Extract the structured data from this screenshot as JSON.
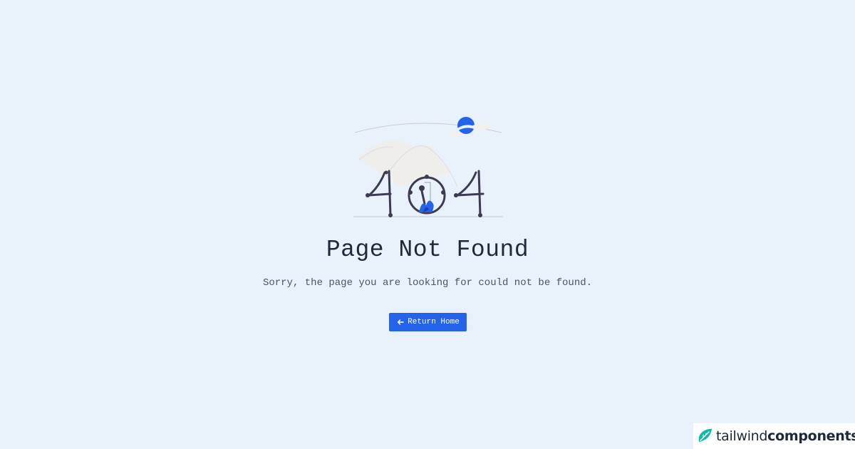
{
  "main": {
    "title": "Page Not Found",
    "message": "Sorry, the page you are looking for could not be found.",
    "return_button_label": "Return Home",
    "return_button_icon": "arrow-left-icon",
    "illustration_icon": "404-illustration",
    "illustration_text": "404"
  },
  "branding": {
    "logo_icon": "tailwind-leaf-icon",
    "name_light": "tailwind",
    "name_bold": "components"
  },
  "colors": {
    "background": "#e9f1fb",
    "accent": "#2563eb",
    "text_primary": "#1f2937",
    "text_secondary": "#4b5563"
  }
}
